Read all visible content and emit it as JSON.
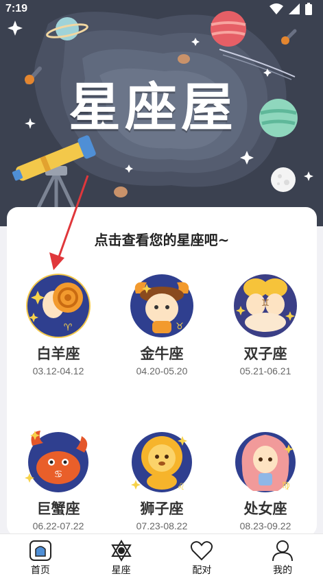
{
  "status_bar": {
    "time": "7:19"
  },
  "hero": {
    "title": "星座屋"
  },
  "main": {
    "prompt": "点击查看您的星座吧~",
    "signs": [
      {
        "name": "白羊座",
        "dates": "03.12-04.12",
        "icon": "aries-icon",
        "symbol": "♈"
      },
      {
        "name": "金牛座",
        "dates": "04.20-05.20",
        "icon": "taurus-icon",
        "symbol": "♉"
      },
      {
        "name": "双子座",
        "dates": "05.21-06.21",
        "icon": "gemini-icon",
        "symbol": "♊"
      },
      {
        "name": "巨蟹座",
        "dates": "06.22-07.22",
        "icon": "cancer-icon",
        "symbol": "♋"
      },
      {
        "name": "狮子座",
        "dates": "07.23-08.22",
        "icon": "leo-icon",
        "symbol": "♌"
      },
      {
        "name": "处女座",
        "dates": "08.23-09.22",
        "icon": "virgo-icon",
        "symbol": "♍"
      }
    ]
  },
  "tabbar": {
    "items": [
      {
        "label": "首页",
        "icon": "home-icon"
      },
      {
        "label": "星座",
        "icon": "star-of-david-icon"
      },
      {
        "label": "配对",
        "icon": "heart-icon"
      },
      {
        "label": "我的",
        "icon": "person-icon"
      }
    ]
  },
  "colors": {
    "hero_bg": "#3b4150",
    "hero_title": "#ffffff",
    "card_bg": "#ffffff",
    "arrow": "#e0373b",
    "zodiac_circle": "#2f3f8f",
    "mascot_orange": "#f29a2e",
    "mascot_skin": "#fde3c2"
  }
}
